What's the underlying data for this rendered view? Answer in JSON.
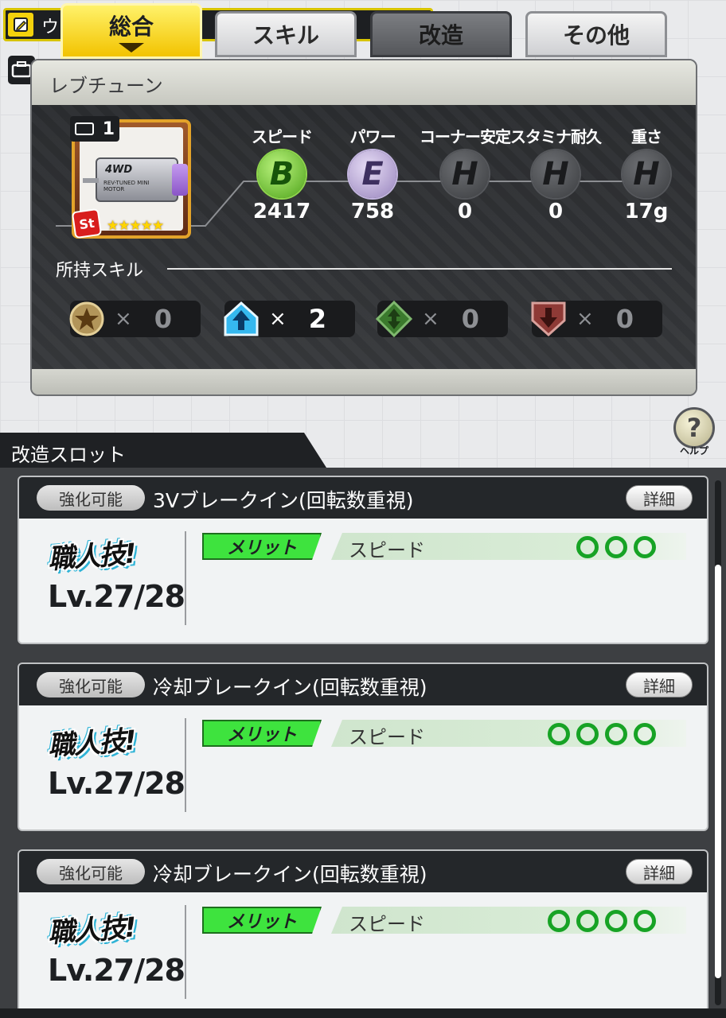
{
  "top": {
    "strip_char": "ウ",
    "tabs": [
      "総合",
      "スキル",
      "改造",
      "その他"
    ]
  },
  "panel": {
    "title": "レブチューン",
    "part": {
      "case_count": "1",
      "badge": "St",
      "stars": "★★★★★",
      "image_text": "4WD",
      "image_subtext": "REV-TUNED MINI MOTOR"
    },
    "stats": [
      {
        "label": "スピード",
        "grade": "B",
        "value": "2417"
      },
      {
        "label": "パワー",
        "grade": "E",
        "value": "758"
      },
      {
        "label": "コーナー安定",
        "grade": "H",
        "value": "0"
      },
      {
        "label": "スタミナ耐久",
        "grade": "H",
        "value": "0"
      },
      {
        "label": "重さ",
        "grade": "H",
        "value": "17g"
      }
    ],
    "skills_title": "所持スキル",
    "skills": [
      {
        "icon": "star-medal-icon",
        "times": "×",
        "count": "0"
      },
      {
        "icon": "up-arrow-icon",
        "times": "×",
        "count": "2"
      },
      {
        "icon": "diamond-arrow-icon",
        "times": "×",
        "count": "0"
      },
      {
        "icon": "down-arrow-icon",
        "times": "×",
        "count": "0"
      }
    ]
  },
  "help": {
    "symbol": "?",
    "label": "ヘルプ"
  },
  "slots_header": "改造スロット",
  "slots": [
    {
      "tag": "強化可能",
      "name": "3Vブレークイン(回転数重視)",
      "detail": "詳細",
      "craft": "職人技!",
      "level": "Lv.27/28",
      "merit": "メリット",
      "effect": "スピード",
      "rings": 3
    },
    {
      "tag": "強化可能",
      "name": "冷却ブレークイン(回転数重視)",
      "detail": "詳細",
      "craft": "職人技!",
      "level": "Lv.27/28",
      "merit": "メリット",
      "effect": "スピード",
      "rings": 4
    },
    {
      "tag": "強化可能",
      "name": "冷却ブレークイン(回転数重視)",
      "detail": "詳細",
      "craft": "職人技!",
      "level": "Lv.27/28",
      "merit": "メリット",
      "effect": "スピード",
      "rings": 4
    }
  ],
  "colors": {
    "tab_active": "#f2c300",
    "grade_b": "#4ea31a",
    "grade_e": "#9884bd",
    "grade_h": "#3b3d40",
    "merit": "#3ee33e",
    "ring": "#17a325"
  }
}
